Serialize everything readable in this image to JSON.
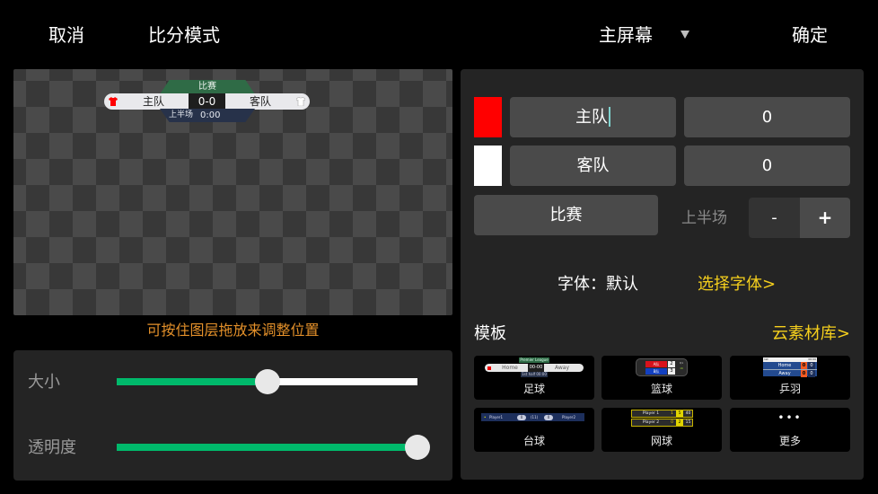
{
  "topbar": {
    "cancel_label": "取消",
    "title": "比分模式",
    "screen_selector": {
      "value": "主屏幕",
      "icon": "caret-down-icon"
    },
    "confirm_label": "确定"
  },
  "preview": {
    "scoreboard": {
      "match_label": "比赛",
      "home_name": "主队",
      "away_name": "客队",
      "score": "0-0",
      "period": "上半场",
      "clock": "0:00",
      "home_color": "#ff0000",
      "away_color": "#ffffff"
    },
    "hint": "可按住图层拖放来调整位置"
  },
  "sliders": {
    "size": {
      "label": "大小",
      "value_percent": 50
    },
    "opacity": {
      "label": "透明度",
      "value_percent": 100
    },
    "accent_color": "#00b96b"
  },
  "editor": {
    "home": {
      "color": "#ff0000",
      "name": "主队",
      "score": "0"
    },
    "away": {
      "color": "#ffffff",
      "name": "客队",
      "score": "0"
    },
    "match_name": "比赛",
    "period": {
      "label": "上半场",
      "minus": "-",
      "plus": "+"
    },
    "font": {
      "label": "字体：默认",
      "link": "选择字体>"
    },
    "templates": {
      "title": "模板",
      "cloud_link": "云素材库>",
      "items": [
        {
          "label": "足球",
          "preview": {
            "league": "Premier League",
            "home": "Home",
            "away": "Away",
            "score": "00-00",
            "bottom": "1st half 00:00"
          }
        },
        {
          "label": "篮球",
          "preview": {
            "team_a": "A队",
            "team_b": "B队",
            "score_a": "2",
            "score_b": "3",
            "info": [
              "Q1",
              "1:00",
              "16"
            ]
          }
        },
        {
          "label": "乒羽",
          "preview": {
            "header_left": "1st",
            "header_right": "00:00",
            "home": "Home",
            "away": "Away",
            "home_games": "0",
            "home_points": "0",
            "away_games": "0",
            "away_points": "0"
          }
        },
        {
          "label": "台球",
          "preview": {
            "player1": "Player1",
            "player2": "Player2",
            "score1": "0",
            "frames": "(11)",
            "score2": "0"
          }
        },
        {
          "label": "网球",
          "preview": {
            "player1": "Player 1",
            "player2": "Player 2",
            "p1": [
              "1",
              "5",
              "40"
            ],
            "p2": [
              "0",
              "2",
              "15"
            ]
          }
        },
        {
          "label": "更多",
          "preview": {
            "icon": "more-dots-icon",
            "glyph": "•••"
          }
        }
      ]
    },
    "link_color": "#f5cf1d"
  }
}
